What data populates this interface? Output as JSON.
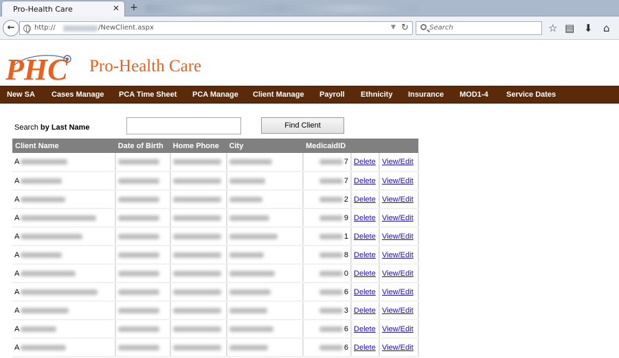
{
  "browser": {
    "tab_title": "Pro-Health Care",
    "tab_close": "✕",
    "new_tab": "+",
    "url_prefix": "http://",
    "url_path": "/NewClient.aspx",
    "search_placeholder": "Search",
    "icons": [
      "back-icon",
      "globe-icon",
      "reload-icon",
      "search-icon",
      "bookmark-star-icon",
      "reading-list-icon",
      "download-icon",
      "home-icon"
    ]
  },
  "brand": {
    "logo_letters": "PHC",
    "name": "Pro-Health Care",
    "color": "#e8621e"
  },
  "menu": {
    "bar_color": "#5a2a0b",
    "items": [
      "New SA",
      "Cases Manage",
      "PCA Time Sheet",
      "PCA Manage",
      "Client Manage",
      "Payroll",
      "Ethnicity",
      "Insurance",
      "MOD1-4",
      "Service Dates"
    ]
  },
  "search": {
    "label_prefix": "Search ",
    "label_bold": "by Last Name",
    "value": "",
    "button": "Find Client"
  },
  "table": {
    "headers": [
      "Client Name",
      "Date of Birth",
      "Home Phone",
      "City",
      "MedicaidID",
      "",
      ""
    ],
    "action_delete": "Delete",
    "action_edit": "View/Edit",
    "rows": [
      {
        "name_initial": "A",
        "medicaid_last": "7"
      },
      {
        "name_initial": "A",
        "medicaid_last": "7"
      },
      {
        "name_initial": "A",
        "medicaid_last": "2"
      },
      {
        "name_initial": "A",
        "medicaid_last": "9"
      },
      {
        "name_initial": "A",
        "medicaid_last": "1"
      },
      {
        "name_initial": "A",
        "medicaid_last": "8"
      },
      {
        "name_initial": "A",
        "medicaid_last": "0"
      },
      {
        "name_initial": "A",
        "medicaid_last": "6"
      },
      {
        "name_initial": "A",
        "medicaid_last": "3"
      },
      {
        "name_initial": "A",
        "medicaid_last": "6"
      },
      {
        "name_initial": "A",
        "medicaid_last": "6"
      }
    ]
  }
}
